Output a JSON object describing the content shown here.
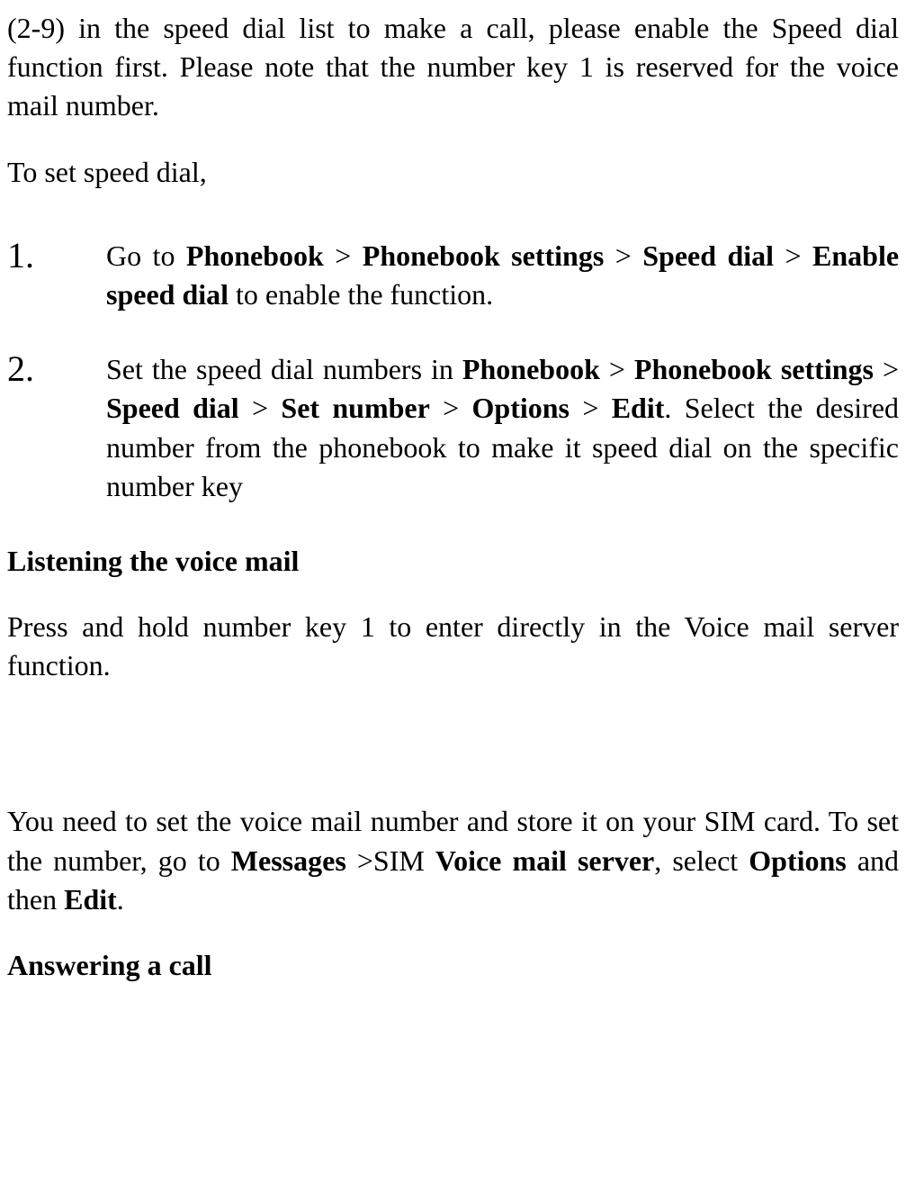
{
  "intro1": {
    "part1": "(2-9) in the speed dial list to make a call, please enable the Speed dial function first. Please note that the number key 1 is reserved for the voice mail number."
  },
  "intro2": "To set speed dial,",
  "steps": {
    "s1": {
      "num": "1.",
      "pre": "Go to ",
      "b1": "Phonebook",
      "sep1": " > ",
      "b2": "Phonebook settings",
      "sep2": " > ",
      "b3": "Speed dial",
      "sep3": " > ",
      "b4": "Enable speed dial",
      "post": " to enable the function."
    },
    "s2": {
      "num": "2.",
      "pre": "Set the speed dial numbers in ",
      "b1": "Phonebook",
      "sep1": " > ",
      "b2": "Phonebook settings",
      "sep2": " > ",
      "b3": "Speed dial",
      "sep3": " > ",
      "b4": "Set number",
      "sep4": " > ",
      "b5": "Options",
      "sep5": " > ",
      "b6": "Edit",
      "post": ". Select the desired number from the phonebook to make it speed dial on the specific number key"
    }
  },
  "heading_voicemail": "Listening the voice mail",
  "voicemail_para": "Press and hold number key 1 to enter directly in the Voice mail server function.",
  "voicemail_setup": {
    "pre": "You need to set the voice mail number and store it on your SIM card. To set the number, go to ",
    "b1": "Messages ",
    "mid1": ">SIM ",
    "b2": "Voice mail server",
    "mid2": ", select ",
    "b3": "Options",
    "mid3": " and then ",
    "b4": "Edit",
    "post": "."
  },
  "heading_answer": "Answering a call"
}
